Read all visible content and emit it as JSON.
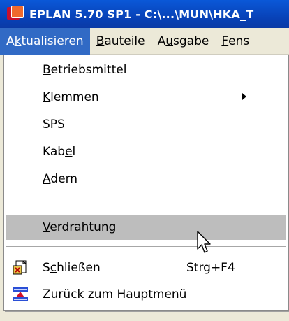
{
  "window": {
    "title": "EPLAN 5.70 SP1 - C:\\...\\MUN\\HKA_T"
  },
  "menubar": [
    {
      "pre": "A",
      "key": "k",
      "post": "tualisieren"
    },
    {
      "pre": "",
      "key": "B",
      "post": "auteile"
    },
    {
      "pre": "A",
      "key": "u",
      "post": "sgabe"
    },
    {
      "pre": "",
      "key": "F",
      "post": "ens"
    }
  ],
  "menu": {
    "items": [
      {
        "pre": "",
        "key": "B",
        "post": "etriebsmittel"
      },
      {
        "pre": "",
        "key": "K",
        "post": "lemmen"
      },
      {
        "pre": "",
        "key": "S",
        "post": "PS"
      },
      {
        "pre": "Kab",
        "key": "e",
        "post": "l"
      },
      {
        "pre": "",
        "key": "A",
        "post": "dern"
      },
      {
        "pre": "",
        "key": "V",
        "post": "erdrahtung"
      },
      {
        "pre": "S",
        "key": "c",
        "post": "hließen",
        "shortcut": "Strg+F4"
      },
      {
        "pre": "",
        "key": "Z",
        "post": "urück zum Hauptmenü"
      }
    ]
  },
  "colors": {
    "titlebar": "#0a58d8",
    "menu_open": "#316ac5",
    "highlight": "#bdbdbd"
  },
  "icons": {
    "app": "eplan-logo-icon",
    "close": "close-document-icon",
    "main_menu": "main-menu-icon",
    "submenu": "submenu-arrow-icon",
    "cursor": "mouse-pointer-icon"
  }
}
